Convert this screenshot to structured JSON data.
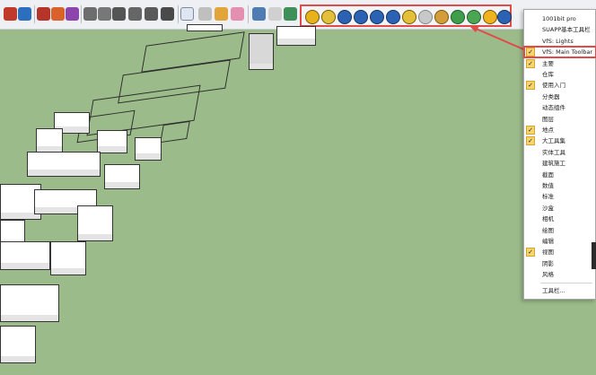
{
  "toolbar": {
    "icons": [
      "move-icon",
      "rotate-icon",
      "component-icon",
      "paint-icon",
      "camera-icon",
      "house-icon",
      "house2-icon",
      "home-icon",
      "warehouse-icon",
      "warehouse2-icon",
      "select-arrow-icon",
      "component-box-icon",
      "paint-bucket-icon",
      "eraser-icon",
      "layer-icon",
      "section-icon",
      "import-icon"
    ]
  },
  "vfs_toolbar": {
    "label": "VfS: Main Toolbar",
    "icons": [
      "vfs-m-icon",
      "vfs-tag-icon",
      "vfs-b-icon",
      "vfs-rt-icon",
      "vfs-br-icon",
      "vfs-help-icon",
      "vfs-tag2-icon",
      "vfs-dot-icon",
      "vfs-cross-icon",
      "vfs-tree-icon",
      "vfs-tree2-icon",
      "vfs-sun-icon",
      "vfs-info-icon"
    ]
  },
  "context_menu": {
    "items": [
      {
        "label": "1001bit pro",
        "checked": false
      },
      {
        "label": "SUAPP基本工具栏",
        "checked": false
      },
      {
        "label": "VfS: Lights",
        "checked": false
      },
      {
        "label": "VfS: Main Toolbar",
        "checked": true,
        "highlighted": true
      },
      {
        "label": "主要",
        "checked": true
      },
      {
        "label": "仓库",
        "checked": false
      },
      {
        "label": "使用入门",
        "checked": true
      },
      {
        "label": "分类器",
        "checked": false
      },
      {
        "label": "动态组件",
        "checked": false
      },
      {
        "label": "图层",
        "checked": false
      },
      {
        "label": "地点",
        "checked": true
      },
      {
        "label": "大工具集",
        "checked": true
      },
      {
        "label": "实体工具",
        "checked": false
      },
      {
        "label": "建筑施工",
        "checked": false
      },
      {
        "label": "截面",
        "checked": false
      },
      {
        "label": "数值",
        "checked": false
      },
      {
        "label": "标准",
        "checked": false
      },
      {
        "label": "沙盒",
        "checked": false
      },
      {
        "label": "相机",
        "checked": false
      },
      {
        "label": "绘图",
        "checked": false
      },
      {
        "label": "编辑",
        "checked": false
      },
      {
        "label": "视图",
        "checked": true
      },
      {
        "label": "阴影",
        "checked": false
      },
      {
        "label": "风格",
        "checked": false
      }
    ],
    "footer": "工具栏..."
  },
  "colors": {
    "viewport_bg": "#9bbb8a",
    "highlight_red": "#e24a4a",
    "check_bg": "#f6d472"
  }
}
